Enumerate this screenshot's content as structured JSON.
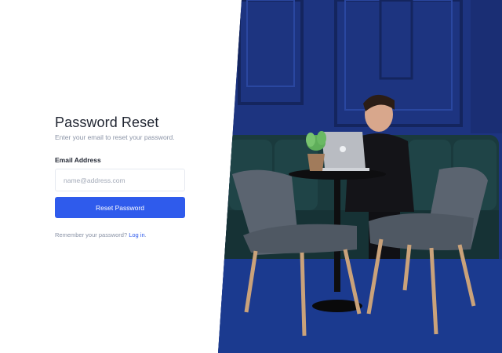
{
  "form": {
    "title": "Password Reset",
    "subtitle": "Enter your email to reset your password.",
    "email_label": "Email Address",
    "email_placeholder": "name@address.com",
    "email_value": "",
    "submit_label": "Reset Password",
    "remember_text": "Remember your password?",
    "login_link": "Log in",
    "remember_suffix": "."
  },
  "colors": {
    "accent": "#2f5bec",
    "heading": "#1f2430",
    "muted": "#8a93a6",
    "wall": "#1d3480"
  },
  "photo": {
    "subject": "man-with-laptop-in-blue-cafe"
  }
}
